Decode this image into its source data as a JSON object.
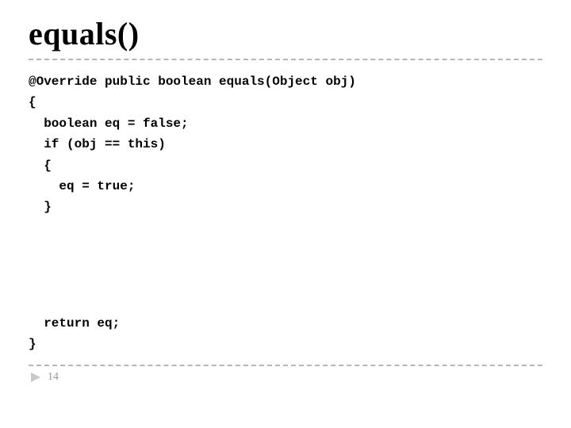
{
  "title": "equals()",
  "code": {
    "line1": "@Override public boolean equals(Object obj)",
    "line2": "{",
    "line3": "  boolean eq = false;",
    "line4": "  if (obj == this)",
    "line5": "  {",
    "line6": "    eq = true;",
    "line7": "  }",
    "line8": "  return eq;",
    "line9": "}"
  },
  "page_number": "14"
}
